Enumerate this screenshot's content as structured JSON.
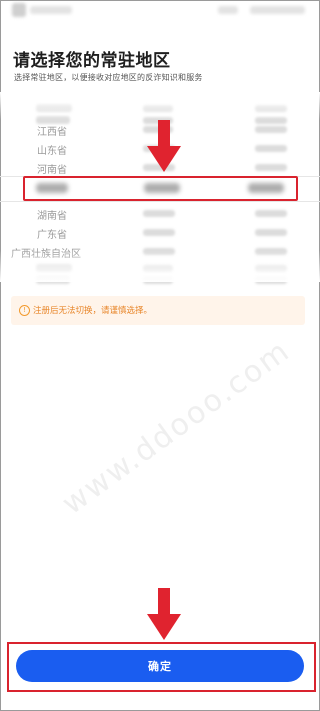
{
  "header": {
    "title": "请选择您的常驻地区",
    "subtitle": "选择常驻地区，以便接收对应地区的反诈知识和服务"
  },
  "picker": {
    "items": [
      "江西省",
      "山东省",
      "河南省",
      "湖南省",
      "广东省",
      "广西壮族自治区"
    ],
    "selected_index": 3
  },
  "notice": {
    "icon": "info-icon",
    "text": "注册后无法切换，请谨慎选择。"
  },
  "watermark": "www.ddooo.com",
  "confirm_label": "确定",
  "colors": {
    "accent": "#1a5df0",
    "highlight": "#d9232e",
    "notice_bg": "#fff4ea",
    "notice_text": "#e8862a"
  }
}
